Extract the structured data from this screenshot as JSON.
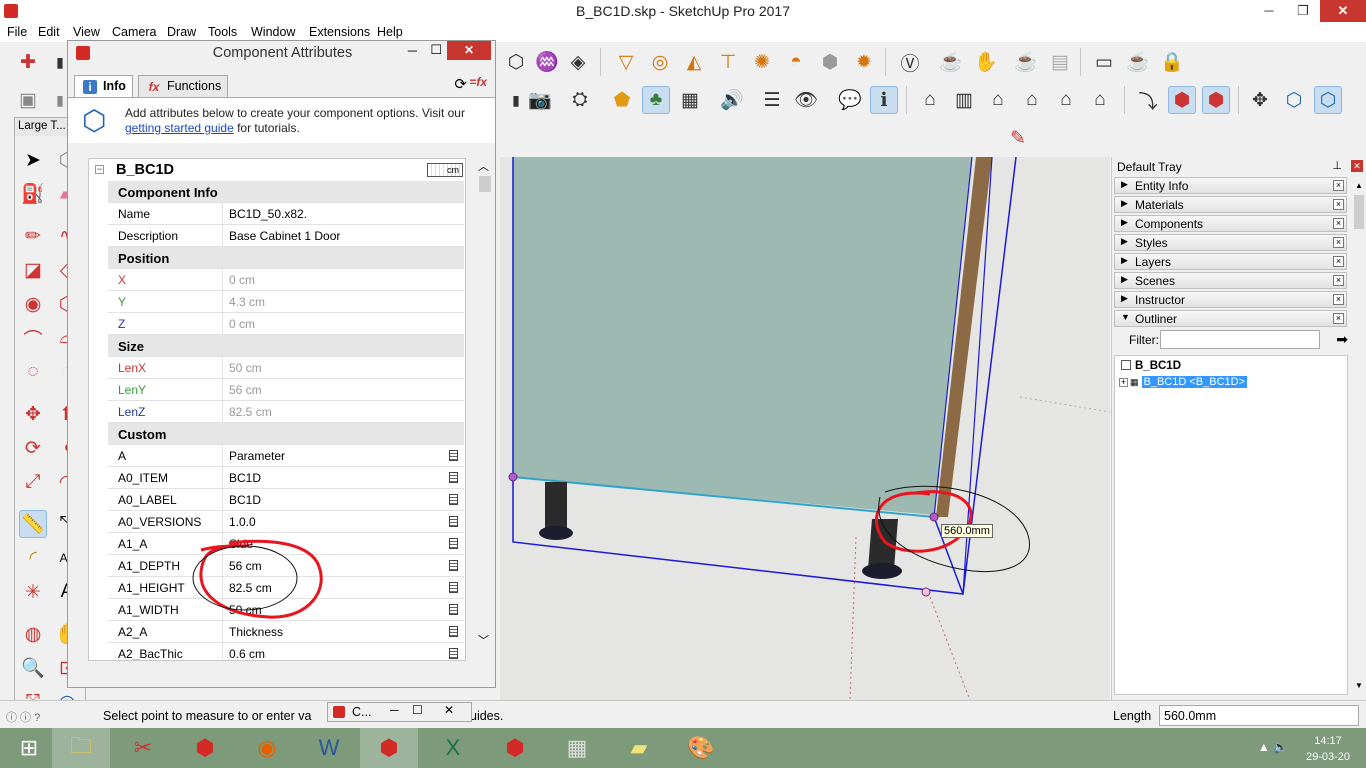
{
  "window": {
    "title": "B_BC1D.skp - SketchUp Pro 2017",
    "minimize": "─",
    "maximize": "❐",
    "close": "✕"
  },
  "menu": [
    "File",
    "Edit",
    "View",
    "Camera",
    "Draw",
    "Tools",
    "Window",
    "Extensions",
    "Help"
  ],
  "large_tool_panel": {
    "title": "Large T...",
    "close": "✕"
  },
  "component_attributes": {
    "title": "Component Attributes",
    "minimize": "─",
    "maximize": "☐",
    "close": "✕",
    "tabs": [
      {
        "label": "Info",
        "icon": "info-icon"
      },
      {
        "label": "Functions",
        "icon": "function-icon"
      }
    ],
    "info_text_before": "Add attributes below to create your component options. Visit our ",
    "info_link": "getting started guide",
    "info_text_after": " for tutorials.",
    "component_name": "B_BC1D",
    "units_badge": "cm",
    "sections": {
      "component_info": "Component Info",
      "position": "Position",
      "size": "Size",
      "custom": "Custom"
    },
    "component_info_rows": [
      {
        "key": "Name",
        "value": "BC1D_50.x82."
      },
      {
        "key": "Description",
        "value": "Base Cabinet 1 Door"
      }
    ],
    "position_rows": [
      {
        "key": "X",
        "value": "0 cm"
      },
      {
        "key": "Y",
        "value": "4.3 cm"
      },
      {
        "key": "Z",
        "value": "0 cm"
      }
    ],
    "size_rows": [
      {
        "key": "LenX",
        "value": "50 cm"
      },
      {
        "key": "LenY",
        "value": "56 cm"
      },
      {
        "key": "LenZ",
        "value": "82.5 cm"
      }
    ],
    "custom_rows": [
      {
        "key": "A",
        "value": "Parameter"
      },
      {
        "key": "A0_ITEM",
        "value": "BC1D"
      },
      {
        "key": "A0_LABEL",
        "value": "BC1D"
      },
      {
        "key": "A0_VERSIONS",
        "value": "1.0.0"
      },
      {
        "key": "A1_A",
        "value": "Side"
      },
      {
        "key": "A1_DEPTH",
        "value": "56 cm"
      },
      {
        "key": "A1_HEIGHT",
        "value": "82.5 cm"
      },
      {
        "key": "A1_WIDTH",
        "value": "50 cm"
      },
      {
        "key": "A2_A",
        "value": "Thickness"
      },
      {
        "key": "A2_BacThic",
        "value": "0.6 cm"
      }
    ]
  },
  "viewport": {
    "dimension_tooltip": "560.0mm"
  },
  "tray": {
    "title": "Default Tray",
    "pin": "📌",
    "close": "✕",
    "panels": [
      {
        "label": "Entity Info",
        "expanded": false
      },
      {
        "label": "Materials",
        "expanded": false
      },
      {
        "label": "Components",
        "expanded": false
      },
      {
        "label": "Styles",
        "expanded": false
      },
      {
        "label": "Layers",
        "expanded": false
      },
      {
        "label": "Scenes",
        "expanded": false
      },
      {
        "label": "Instructor",
        "expanded": false
      },
      {
        "label": "Outliner",
        "expanded": true
      }
    ],
    "filter_label": "Filter:",
    "filter_value": "",
    "outliner_root": "B_BC1D",
    "outliner_child": "B_BC1D <B_BC1D>"
  },
  "statusbar": {
    "hint": "Select point to measure to or enter va",
    "hint_tail": "uides.",
    "mini_dialog_title": "C...",
    "vcb_label": "Length",
    "vcb_value": "560.0mm"
  },
  "taskbar": {
    "time": "14:17",
    "date": "29-03-20"
  },
  "colors": {
    "selection_blue": "#3399ff",
    "annotation_red": "#e8141e",
    "window_close_red": "#c7372f",
    "cabinet_panel": "#9db9b1",
    "taskbar_green": "#7d9a7b"
  }
}
